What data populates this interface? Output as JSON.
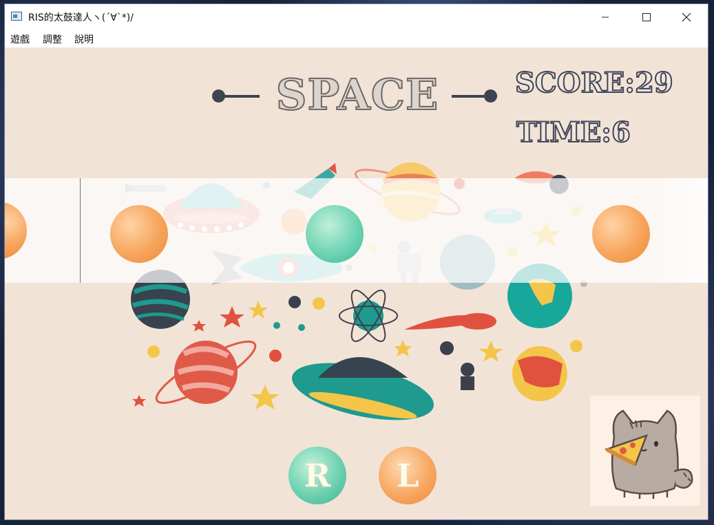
{
  "window": {
    "title": "RIS的太鼓達人ヽ(´∀`*)/",
    "controls": {
      "minimize": "minimize",
      "maximize": "maximize",
      "close": "close"
    }
  },
  "menu": {
    "items": [
      "遊戲",
      "調整",
      "說明"
    ]
  },
  "game": {
    "title": "SPACE",
    "score_text": "SCORE:29",
    "time_text": "TIME:6",
    "keys": {
      "right": "R",
      "left": "L"
    }
  },
  "colors": {
    "background": "#f2e3d7",
    "orange_note": "#f6a55c",
    "teal_note": "#6fd4b4",
    "text_outline": "#3f4456"
  },
  "icons": [
    "pusheen-cat-pizza-icon",
    "planet-icon",
    "rocket-icon",
    "ufo-icon",
    "robot-icon",
    "star-icon",
    "comet-icon"
  ]
}
